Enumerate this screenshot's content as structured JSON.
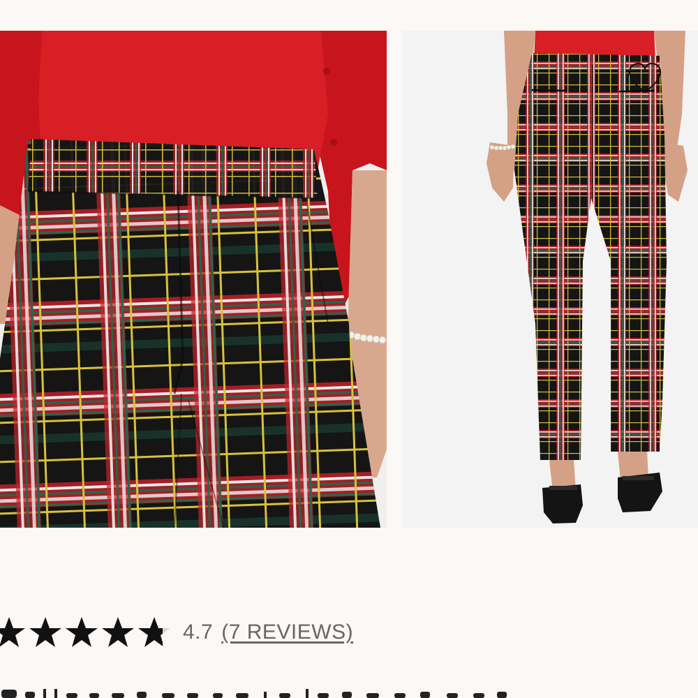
{
  "gallery": {
    "images": [
      {
        "name": "front-closeup",
        "alt": ""
      },
      {
        "name": "back-full-length",
        "alt": ""
      }
    ],
    "wishlist_icon": "heart-outline-icon"
  },
  "rating": {
    "value_number": 4.7,
    "max": 5,
    "value": "4.7",
    "reviews_label": "(7 REVIEWS)",
    "star_color": "#111111",
    "star_empty_color": "#d6d6d6"
  },
  "colors": {
    "background": "#fbf8f6",
    "sweater_red": "#d21c22",
    "plaid_black": "#151515",
    "plaid_red": "#c5232b",
    "plaid_yellow": "#d8c13c",
    "plaid_green": "#1f6b4c",
    "plaid_white": "#e9e9e9"
  }
}
